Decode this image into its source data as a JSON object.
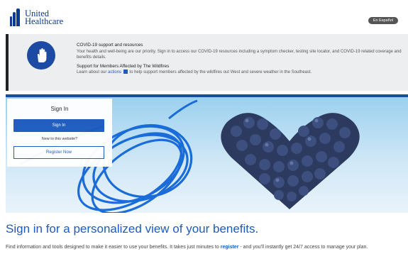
{
  "header": {
    "logo_line1": "United",
    "logo_line2": "Healthcare",
    "lang_button": "En Español"
  },
  "alert": {
    "title": "COVID-19 support and resources",
    "text": "Your health and well-being are our priority. Sign in to access our COVID-19 resources including a symptom checker, testing site locator, and COVID-19 related coverage and benefits details.",
    "title2": "Support for Members Affected by The Wildfires",
    "text2_before": "Learn about our",
    "text2_link": "actions",
    "text2_after": "to help support members affected by the wildfires out West and severe weather in the Southeast."
  },
  "signin": {
    "heading": "Sign In",
    "signin_button": "Sign In",
    "new_text": "New to this website?",
    "register_button": "Register Now"
  },
  "main": {
    "headline": "Sign in for a personalized view of your benefits.",
    "body_before": "Find information and tools designed to make it easier to use your benefits. It takes just minutes to",
    "body_link": "register",
    "body_after": "- and you'll instantly get 24/7 access to manage your plan."
  }
}
